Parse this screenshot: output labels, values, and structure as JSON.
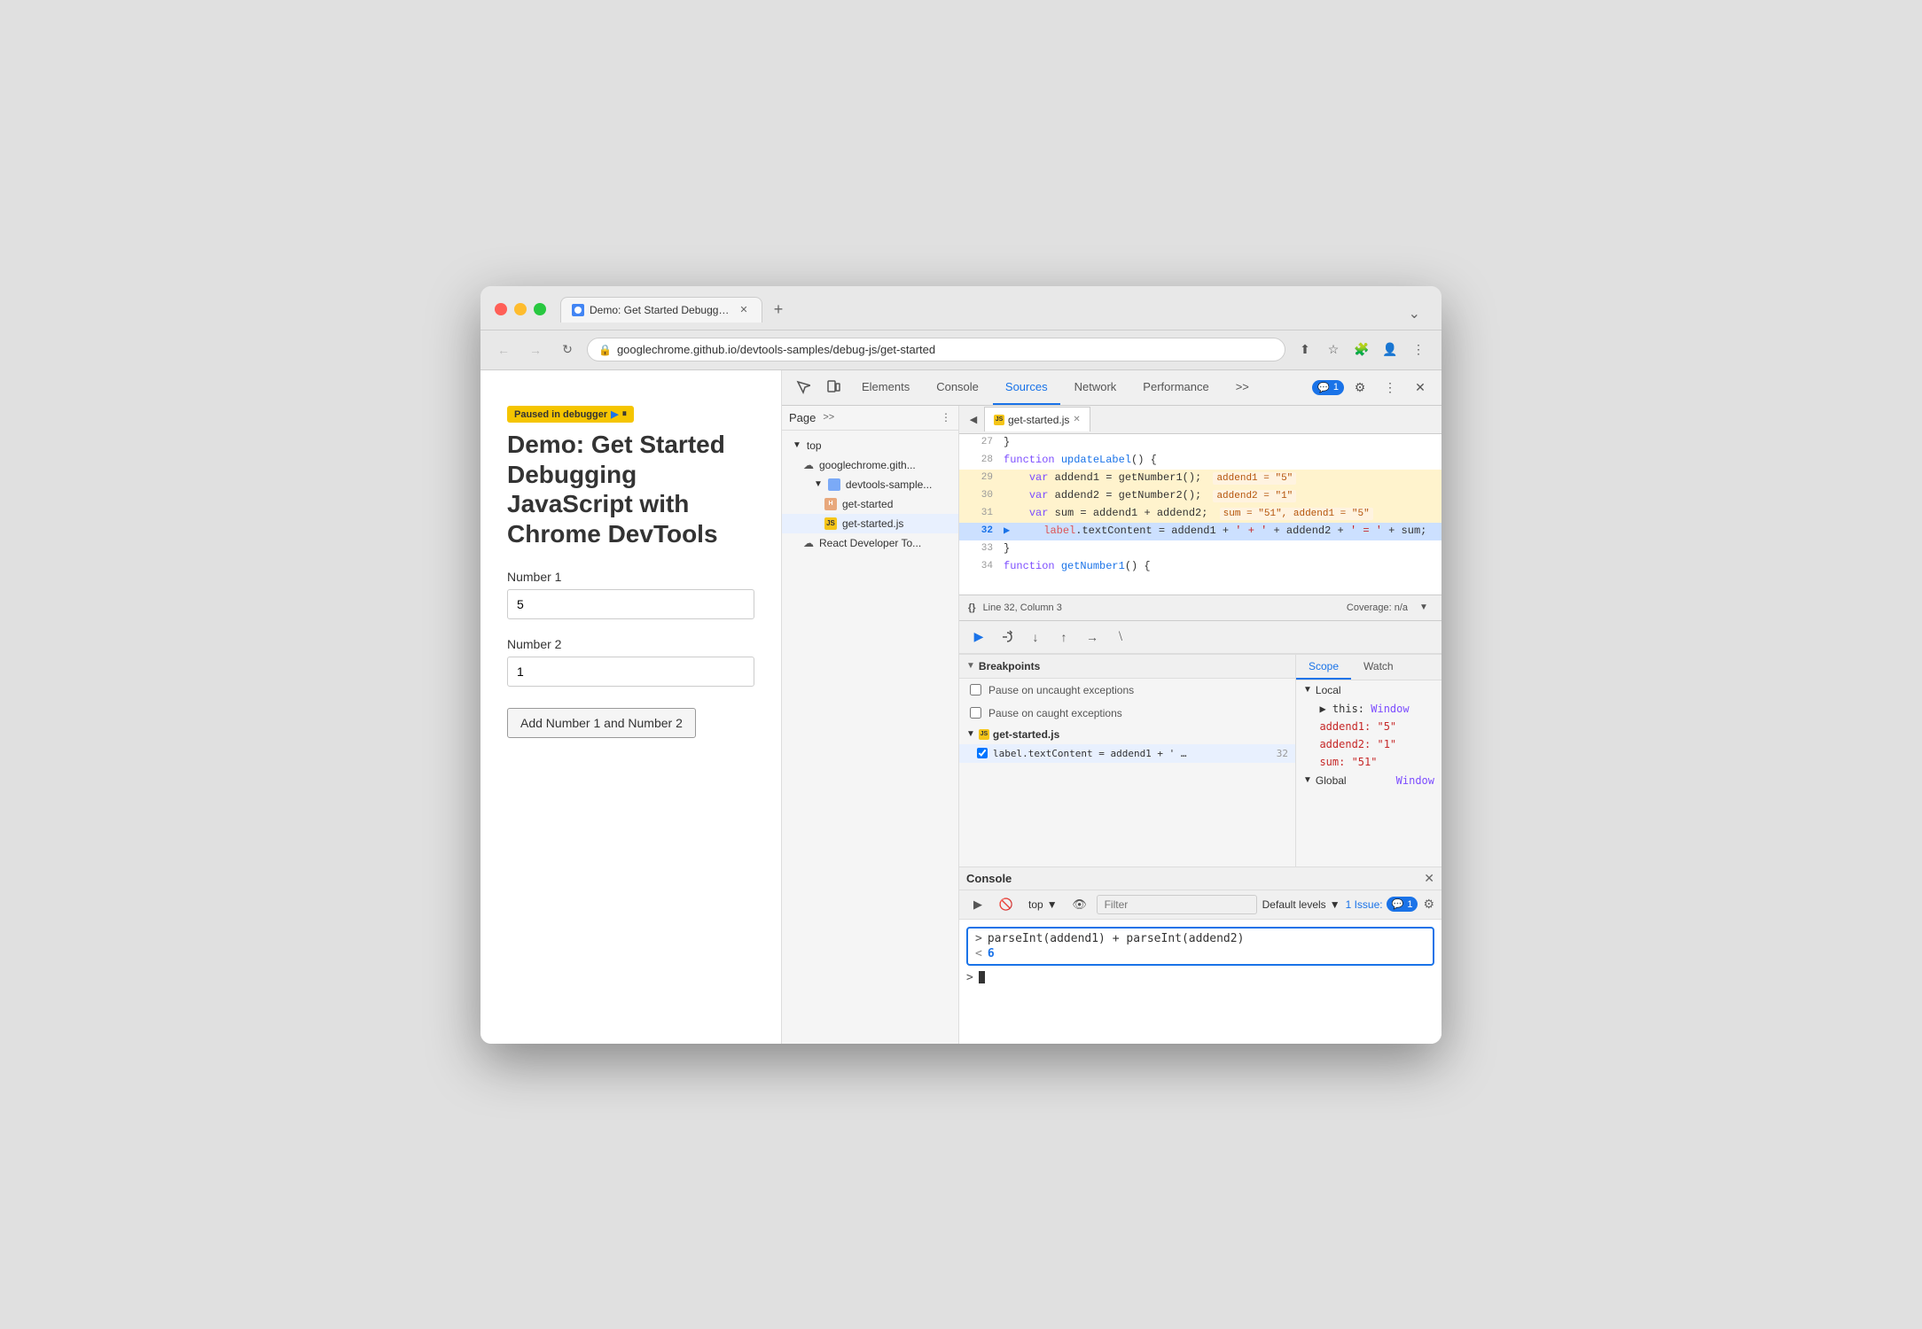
{
  "browser": {
    "tab_title": "Demo: Get Started Debugging",
    "url": "googlechrome.github.io/devtools-samples/debug-js/get-started",
    "new_tab_label": "+",
    "overflow_label": "⌄"
  },
  "nav": {
    "back_label": "←",
    "forward_label": "→",
    "refresh_label": "↻",
    "share_label": "⬆",
    "bookmark_label": "☆",
    "extensions_label": "🧩",
    "profile_label": "👤",
    "menu_label": "⋮"
  },
  "demo_page": {
    "paused_banner": "Paused in debugger",
    "title": "Demo: Get Started Debugging JavaScript with Chrome DevTools",
    "number1_label": "Number 1",
    "number1_value": "5",
    "number2_label": "Number 2",
    "number2_value": "1",
    "add_button_label": "Add Number 1 and Number 2"
  },
  "devtools": {
    "tabs": [
      "Elements",
      "Console",
      "Sources",
      "Network",
      "Performance"
    ],
    "active_tab": "Sources",
    "more_tabs_label": ">>",
    "badge_count": "1",
    "settings_label": "⚙",
    "more_label": "⋮",
    "close_label": "✕"
  },
  "sources": {
    "page_tab": "Page",
    "more_label": ">>",
    "options_label": "⋮",
    "editor_prev_btn": "◀",
    "editor_file_name": "get-started.js",
    "editor_close_btn": "✕",
    "status_bar": {
      "line_col": "Line 32, Column 3",
      "coverage": "Coverage: n/a",
      "collapse_icon": "▼"
    },
    "file_tree": [
      {
        "name": "top",
        "type": "root",
        "indent": 0
      },
      {
        "name": "googlechrome.gith...",
        "type": "cloud",
        "indent": 1
      },
      {
        "name": "devtools-sample...",
        "type": "folder",
        "indent": 2
      },
      {
        "name": "get-started",
        "type": "html",
        "indent": 3
      },
      {
        "name": "get-started.js",
        "type": "js",
        "indent": 3
      },
      {
        "name": "React Developer To...",
        "type": "cloud",
        "indent": 1
      }
    ],
    "code_lines": [
      {
        "num": 27,
        "content": "}",
        "highlighted": false,
        "active": false
      },
      {
        "num": 28,
        "content": "function updateLabel() {",
        "highlighted": false,
        "active": false
      },
      {
        "num": 29,
        "content": "    var addend1 = getNumber1();",
        "highlighted": true,
        "active": false,
        "inline_val": "addend1 = \"5\""
      },
      {
        "num": 30,
        "content": "    var addend2 = getNumber2();",
        "highlighted": true,
        "active": false,
        "inline_val": "addend2 = \"1\""
      },
      {
        "num": 31,
        "content": "    var sum = addend1 + addend2;",
        "highlighted": true,
        "active": false,
        "inline_val": "sum = \"51\", addend1 = \"5\""
      },
      {
        "num": 32,
        "content": "    label.textContent = addend1 + ' + ' + addend2 + ' = ' + sum;",
        "highlighted": false,
        "active": true
      },
      {
        "num": 33,
        "content": "}",
        "highlighted": false,
        "active": false
      },
      {
        "num": 34,
        "content": "function getNumber1() {",
        "highlighted": false,
        "active": false
      }
    ]
  },
  "debugger_toolbar": {
    "resume_btn": "▶",
    "step_over_btn": "↻",
    "step_into_btn": "↓",
    "step_out_btn": "↑",
    "step_btn": "→",
    "deactivate_btn": "⧵"
  },
  "breakpoints": {
    "header": "Breakpoints",
    "pause_uncaught_label": "Pause on uncaught exceptions",
    "pause_caught_label": "Pause on caught exceptions",
    "file_name": "get-started.js",
    "bp_code": "label.textContent = addend1 + ' …",
    "bp_line": "32"
  },
  "scope": {
    "tabs": [
      "Scope",
      "Watch"
    ],
    "active_tab": "Scope",
    "local_header": "Local",
    "local_items": [
      {
        "key": "▶ this:",
        "val": "Window",
        "is_link": false
      },
      {
        "key": "addend1:",
        "val": "\"5\"",
        "color": "red"
      },
      {
        "key": "addend2:",
        "val": "\"1\"",
        "color": "red"
      },
      {
        "key": "sum:",
        "val": "\"51\"",
        "color": "red"
      }
    ],
    "global_header": "Global",
    "global_val": "Window"
  },
  "console": {
    "header": "Console",
    "close_btn": "✕",
    "execute_btn": "▶",
    "clear_btn": "🚫",
    "context_label": "top",
    "context_arrow": "▼",
    "eye_btn": "👁",
    "filter_placeholder": "Filter",
    "levels_label": "Default levels",
    "levels_arrow": "▼",
    "issues_label": "1 Issue:",
    "issues_badge": "1",
    "gear_btn": "⚙",
    "console_input": "parseInt(addend1) + parseInt(addend2)",
    "console_result": "6",
    "cursor_label": ">"
  }
}
